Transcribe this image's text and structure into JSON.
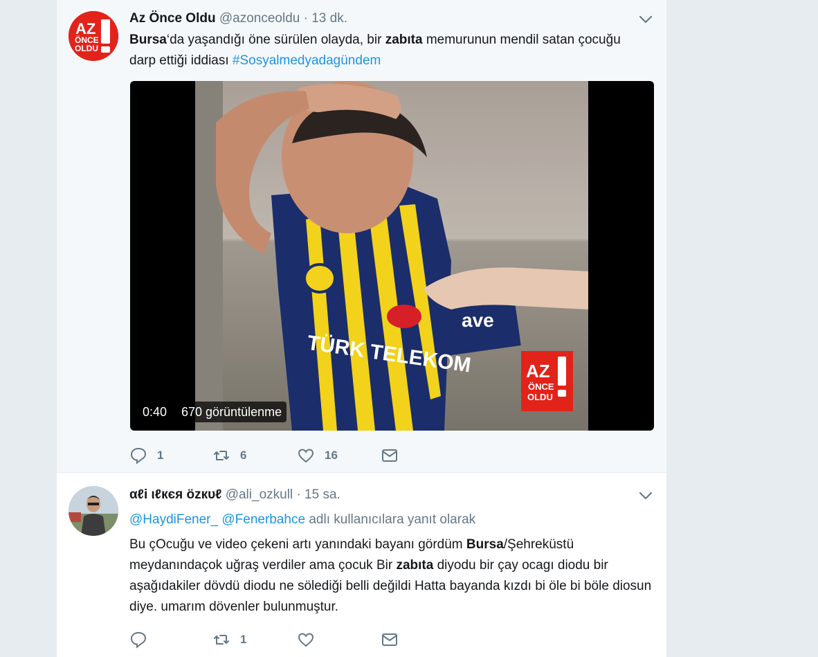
{
  "tweets": [
    {
      "fullname": "Az Önce Oldu",
      "handle": "@azonceoldu",
      "separator": "·",
      "time": "13 dk.",
      "avatar_text": {
        "line1": "AZ",
        "line2": "ÖNCE",
        "line3": "OLDU"
      },
      "text": {
        "part1": "Bursa",
        "part2": "‘da yaşandığı öne sürülen olayda, bir ",
        "part3": "zabıta",
        "part4": " memurunun mendil satan çocuğu darp ettiği iddiası ",
        "hashtag": "#Sosyalmedyadagündem"
      },
      "media": {
        "duration": "0:40",
        "views": "670 görüntülenme",
        "jersey_text": "TÜRK TELEKOM",
        "logo_text": {
          "line1": "AZ",
          "line2": "ÖNCE",
          "line3": "OLDU"
        }
      },
      "actions": {
        "replies": "1",
        "retweets": "6",
        "likes": "16"
      }
    },
    {
      "fullname": "αℓi ιℓкєя özкυℓ",
      "handle": "@ali_ozkull",
      "separator": "·",
      "time": "15 sa.",
      "reply_to": {
        "mention1": "@HaydiFener_",
        "mention2": "@Fenerbahce",
        "suffix": " adlı kullanıcılara yanıt olarak"
      },
      "text": {
        "part1": "Bu çOcuğu ve video çekeni artı yanındaki bayanı gördüm ",
        "part2": "Bursa",
        "part3": "/Şehreküstü meydanındaçok uğraş verdiler ama çocuk Bir ",
        "part4": "zabıta",
        "part5": " diyodu bir çay ocagı diodu bir aşağıdakiler dövdü diodu ne sölediği belli değildi Hatta bayanda kızdı bi öle bi böle diosun diye. umarım dövenler bulunmuştur."
      },
      "actions": {
        "replies": "",
        "retweets": "1",
        "likes": ""
      }
    }
  ],
  "colors": {
    "brand_red": "#e2231a",
    "link": "#1b95e0",
    "muted": "#657786",
    "bg": "#e6ecf0"
  },
  "icons": [
    "chevron-down-icon",
    "reply-icon",
    "retweet-icon",
    "like-icon",
    "direct-message-icon"
  ]
}
